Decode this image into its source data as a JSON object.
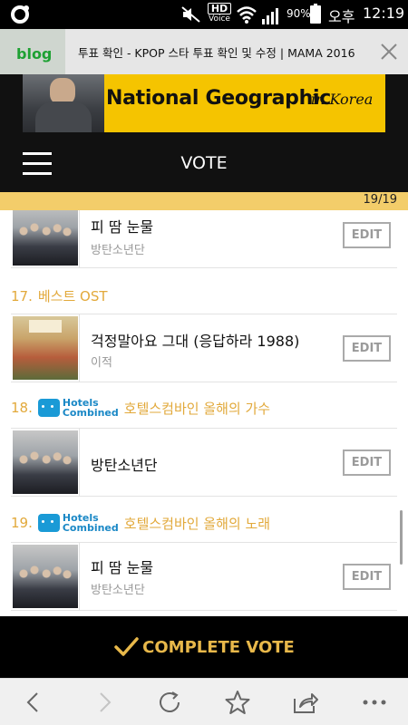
{
  "status_bar": {
    "hd": "HD",
    "voice": "Voice",
    "battery": "90%",
    "ampm": "오후",
    "time": "12:19"
  },
  "browser_tab": {
    "site_label": "blog",
    "title": "투표 확인 - KPOP 스타 투표 확인 및 수정 | MAMA 2016"
  },
  "ad": {
    "title": "National Geographic",
    "subtitle": "in Korea"
  },
  "header": {
    "title": "VOTE"
  },
  "progress": {
    "text": "19/19",
    "fraction": 1.0,
    "color": "#f3cd6a"
  },
  "categories": [
    {
      "number": "17.",
      "title": "베스트 OST",
      "has_sponsor": false
    },
    {
      "number": "18.",
      "title": "호텔스컴바인 올해의 가수",
      "has_sponsor": true,
      "sponsor_line1": "Hotels",
      "sponsor_line2": "Combined"
    },
    {
      "number": "19.",
      "title": "호텔스컴바인 올해의 노래",
      "has_sponsor": true,
      "sponsor_line1": "Hotels",
      "sponsor_line2": "Combined"
    }
  ],
  "items": [
    {
      "song": "피 땀 눈물",
      "artist": "방탄소년단",
      "edit": "EDIT"
    },
    {
      "song": "걱정말아요 그대 (응답하라 1988)",
      "artist": "이적",
      "edit": "EDIT"
    },
    {
      "song": "방탄소년단",
      "artist": "",
      "edit": "EDIT"
    },
    {
      "song": "피 땀 눈물",
      "artist": "방탄소년단",
      "edit": "EDIT"
    }
  ],
  "complete_vote": "COMPLETE VOTE",
  "colors": {
    "accent": "#e2a93b",
    "header_bg": "#111111",
    "progress": "#f3cd6a",
    "sponsor_blue": "#1a88c6"
  },
  "icons": {
    "app": "circle-app-icon",
    "mute": "mute-icon",
    "wifi": "wifi-icon",
    "signal": "signal-icon",
    "battery": "battery-icon",
    "close": "close-icon",
    "menu": "hamburger-icon",
    "check": "check-icon",
    "back": "back-icon",
    "forward": "forward-icon",
    "reload": "reload-icon",
    "bookmark": "star-icon",
    "share": "share-icon",
    "more": "more-icon"
  }
}
